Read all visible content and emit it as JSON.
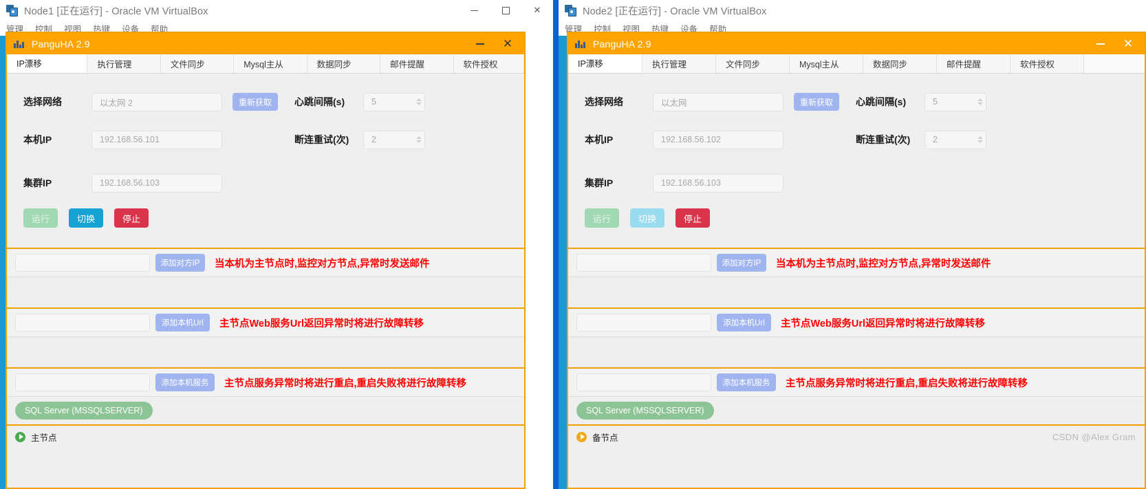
{
  "desktop": {
    "background": "#0b5fd4"
  },
  "watermark": "CSDN @Alex Gram",
  "nodes": [
    {
      "id": "node1",
      "vbox": {
        "title": "Node1 [正在运行] - Oracle VM VirtualBox",
        "icon": "virtualbox-icon",
        "menus": [
          "管理",
          "控制",
          "视图",
          "热键",
          "设备",
          "帮助"
        ],
        "controls": {
          "minimize": "—",
          "maximize": "□",
          "close": "✕"
        }
      },
      "app": {
        "title": "PanguHA 2.9",
        "icon": "panguha-icon",
        "controls": {
          "minimize": "—",
          "close": "✕"
        },
        "tabs": [
          {
            "label": "IP漂移",
            "active": true
          },
          {
            "label": "执行管理",
            "active": false
          },
          {
            "label": "文件同步",
            "active": false
          },
          {
            "label": "Mysql主从",
            "active": false
          },
          {
            "label": "数据同步",
            "active": false
          },
          {
            "label": "邮件提醒",
            "active": false
          },
          {
            "label": "软件授权",
            "active": false
          }
        ],
        "form": {
          "network_label": "选择网络",
          "network_value": "以太网 2",
          "refresh_button": "重新获取",
          "heartbeat_label": "心跳间隔(s)",
          "heartbeat_value": "5",
          "local_ip_label": "本机IP",
          "local_ip_value": "192.168.56.101",
          "retry_label": "断连重试(次)",
          "retry_value": "2",
          "cluster_ip_label": "集群IP",
          "cluster_ip_value": "192.168.56.103"
        },
        "actions": [
          {
            "label": "运行",
            "color": "#a0d8b3",
            "enabled": false
          },
          {
            "label": "切换",
            "color": "#17a2d4",
            "enabled": true
          },
          {
            "label": "停止",
            "color": "#d9344a",
            "enabled": true
          }
        ],
        "panels": [
          {
            "input_value": "",
            "button": "添加对方IP",
            "hint": "当本机为主节点时,监控对方节点,异常时发送邮件"
          },
          {
            "input_value": "",
            "button": "添加本机Url",
            "hint": "主节点Web服务Url返回异常时将进行故障转移"
          },
          {
            "input_value": "",
            "button": "添加本机服务",
            "hint": "主节点服务异常时将进行重启,重启失败将进行故障转移"
          }
        ],
        "service_tag": "SQL Server (MSSQLSERVER)",
        "status": {
          "text": "主节点",
          "dot_color": "#49a94f",
          "icon": "play-circle-icon"
        }
      }
    },
    {
      "id": "node2",
      "vbox": {
        "title": "Node2 [正在运行] - Oracle VM VirtualBox",
        "icon": "virtualbox-icon",
        "menus": [
          "管理",
          "控制",
          "视图",
          "热键",
          "设备",
          "帮助"
        ],
        "controls": {
          "minimize": "—",
          "maximize": "□",
          "close": "✕"
        }
      },
      "app": {
        "title": "PanguHA 2.9",
        "icon": "panguha-icon",
        "controls": {
          "minimize": "—",
          "close": "✕"
        },
        "tabs": [
          {
            "label": "IP漂移",
            "active": true
          },
          {
            "label": "执行管理",
            "active": false
          },
          {
            "label": "文件同步",
            "active": false
          },
          {
            "label": "Mysql主从",
            "active": false
          },
          {
            "label": "数据同步",
            "active": false
          },
          {
            "label": "邮件提醒",
            "active": false
          },
          {
            "label": "软件授权",
            "active": false
          }
        ],
        "form": {
          "network_label": "选择网络",
          "network_value": "以太网",
          "refresh_button": "重新获取",
          "heartbeat_label": "心跳间隔(s)",
          "heartbeat_value": "5",
          "local_ip_label": "本机IP",
          "local_ip_value": "192.168.56.102",
          "retry_label": "断连重试(次)",
          "retry_value": "2",
          "cluster_ip_label": "集群IP",
          "cluster_ip_value": "192.168.56.103"
        },
        "actions": [
          {
            "label": "运行",
            "color": "#a0d8b3",
            "enabled": false
          },
          {
            "label": "切换",
            "color": "#9adcef",
            "enabled": false
          },
          {
            "label": "停止",
            "color": "#d9344a",
            "enabled": true
          }
        ],
        "panels": [
          {
            "input_value": "",
            "button": "添加对方IP",
            "hint": "当本机为主节点时,监控对方节点,异常时发送邮件"
          },
          {
            "input_value": "",
            "button": "添加本机Url",
            "hint": "主节点Web服务Url返回异常时将进行故障转移"
          },
          {
            "input_value": "",
            "button": "添加本机服务",
            "hint": "主节点服务异常时将进行重启,重启失败将进行故障转移"
          }
        ],
        "service_tag": "SQL Server (MSSQLSERVER)",
        "status": {
          "text": "备节点",
          "dot_color": "#f0a81e",
          "icon": "play-circle-icon"
        }
      }
    }
  ]
}
